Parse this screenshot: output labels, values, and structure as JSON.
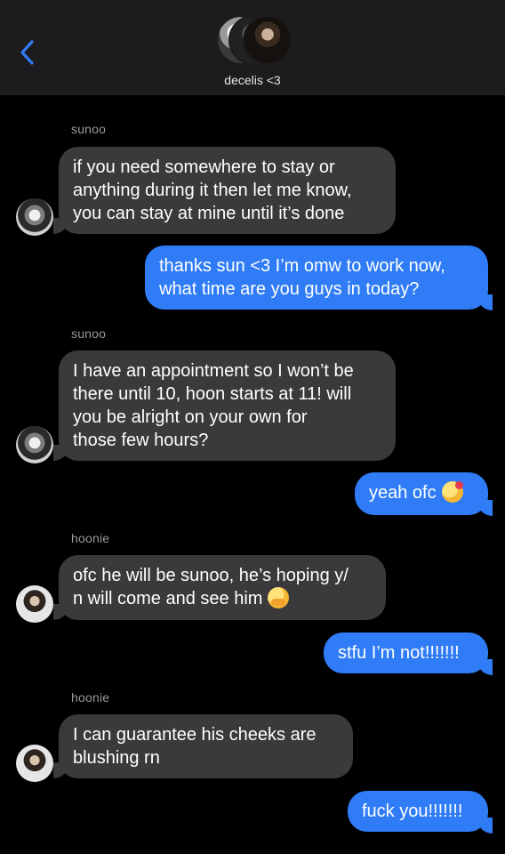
{
  "header": {
    "chat_title": "decelis <3"
  },
  "messages": [
    {
      "sender": "sunoo",
      "lines": [
        "if you need somewhere to stay or",
        "anything during it then let me know,",
        "you can stay at mine until it’s done"
      ]
    },
    {
      "lines": [
        "thanks sun <3 I’m omw to work now,",
        "what time are you guys in today?"
      ]
    },
    {
      "sender": "sunoo",
      "lines": [
        "I have an appointment so I won’t be",
        "there until 10, hoon starts at 11! will",
        "you be alright on your own for",
        "those few hours?"
      ]
    },
    {
      "lines": [
        "yeah ofc"
      ],
      "emoji": "smiling-face-with-hearts"
    },
    {
      "sender": "hoonie",
      "lines": [
        "ofc he will be sunoo, he’s hoping y/",
        "n will come and see him"
      ],
      "emoji": "hand-over-mouth-face"
    },
    {
      "lines": [
        "stfu I’m not!!!!!!!"
      ]
    },
    {
      "sender": "hoonie",
      "lines": [
        "I can guarantee his cheeks are",
        "blushing rn"
      ]
    },
    {
      "lines": [
        "fuck you!!!!!!!"
      ]
    }
  ],
  "icons": {
    "back": "chevron-left-icon"
  },
  "colors": {
    "background": "#000000",
    "header": "#1c1c1e",
    "incoming_bubble": "#3a3a3c",
    "outgoing_bubble": "#2f7cf6",
    "back_arrow": "#2f7cf6",
    "sender_label": "#9a9a9f"
  }
}
